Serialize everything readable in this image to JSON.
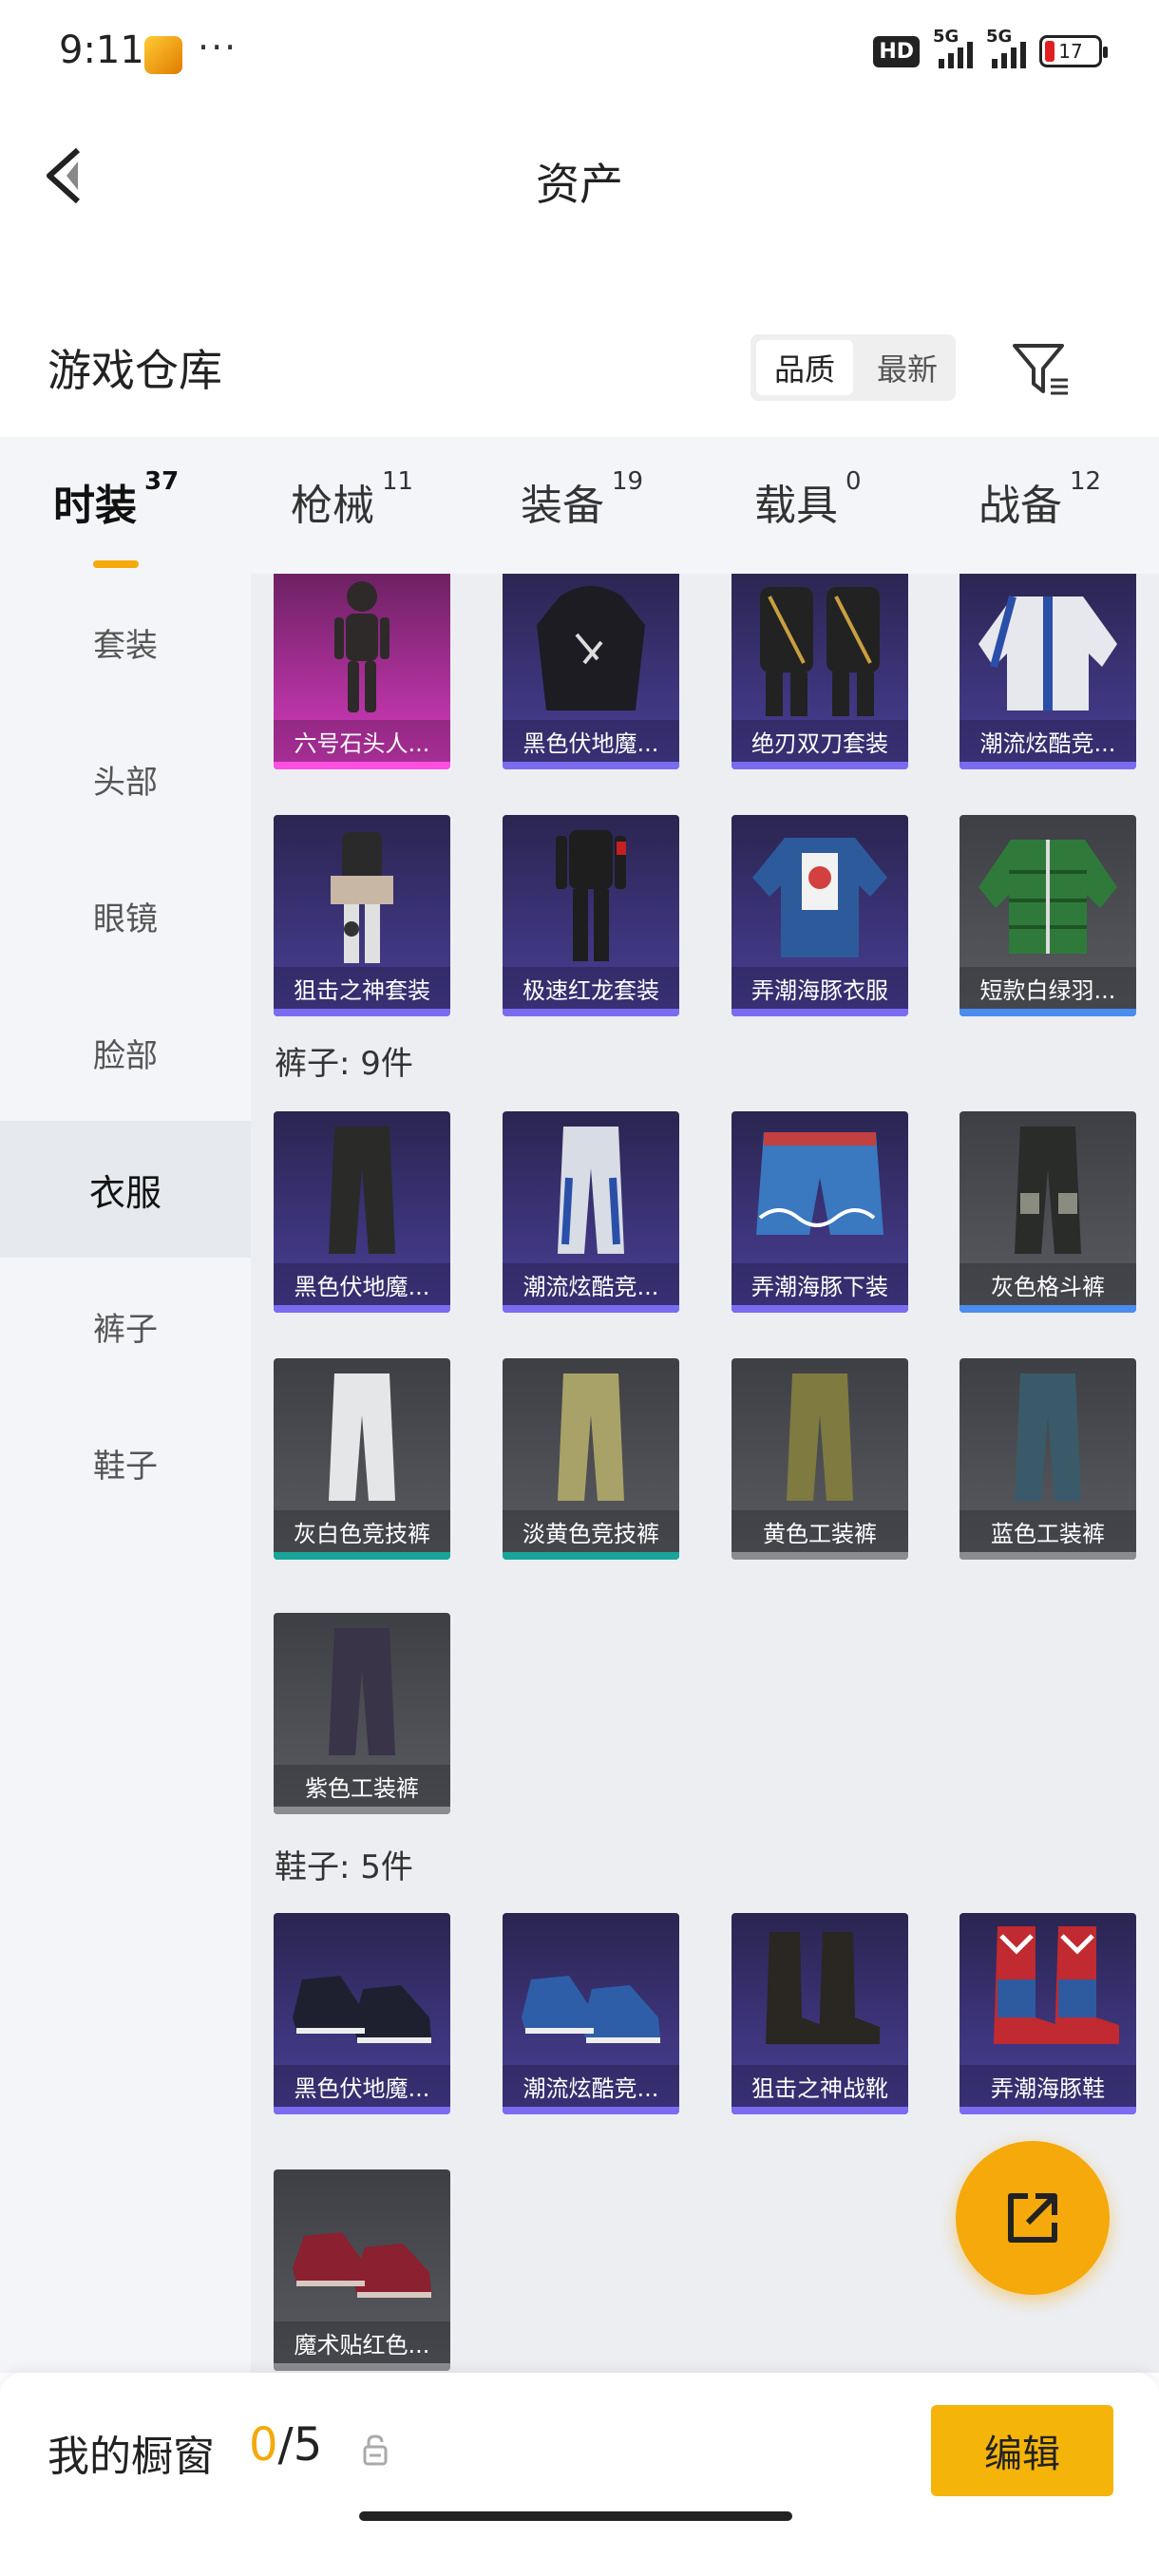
{
  "status": {
    "time": "9:11",
    "dots": "···",
    "hd": "HD",
    "net1": "5G",
    "net2": "5G",
    "battery": "17"
  },
  "nav": {
    "title": "资产"
  },
  "warehouse": {
    "title": "游戏仓库",
    "sort_options": [
      "品质",
      "最新"
    ],
    "sort_active": "品质"
  },
  "category_tabs": [
    {
      "label": "时装",
      "count": "37",
      "active": true
    },
    {
      "label": "枪械",
      "count": "11"
    },
    {
      "label": "装备",
      "count": "19"
    },
    {
      "label": "载具",
      "count": "0"
    },
    {
      "label": "战备",
      "count": "12"
    }
  ],
  "sidebar": [
    {
      "label": "套装"
    },
    {
      "label": "头部"
    },
    {
      "label": "眼镜"
    },
    {
      "label": "脸部"
    },
    {
      "label": "衣服",
      "active": true
    },
    {
      "label": "裤子"
    },
    {
      "label": "鞋子"
    }
  ],
  "groups": {
    "clothes": {
      "items": [
        {
          "label": "六号石头人...",
          "rarity": "pink",
          "icon": "armor-suit-icon"
        },
        {
          "label": "黑色伏地魔...",
          "rarity": "purple",
          "icon": "hoodie-icon"
        },
        {
          "label": "绝刃双刀套装",
          "rarity": "purple",
          "icon": "outfit-pair-icon"
        },
        {
          "label": "潮流炫酷竞...",
          "rarity": "purple",
          "icon": "jacket-icon"
        },
        {
          "label": "狙击之神套装",
          "rarity": "purple",
          "icon": "outfit-icon"
        },
        {
          "label": "极速红龙套装",
          "rarity": "purple",
          "icon": "outfit-icon"
        },
        {
          "label": "弄潮海豚衣服",
          "rarity": "purple",
          "icon": "shirt-icon"
        },
        {
          "label": "短款白绿羽...",
          "rarity": "grey-blue",
          "icon": "down-jacket-icon"
        }
      ]
    },
    "pants": {
      "title": "裤子: 9件",
      "items": [
        {
          "label": "黑色伏地魔...",
          "rarity": "purple",
          "icon": "pants-icon"
        },
        {
          "label": "潮流炫酷竞...",
          "rarity": "purple",
          "icon": "pants-icon"
        },
        {
          "label": "弄潮海豚下装",
          "rarity": "purple",
          "icon": "shorts-icon"
        },
        {
          "label": "灰色格斗裤",
          "rarity": "grey-blue",
          "icon": "pants-icon"
        },
        {
          "label": "灰白色竞技裤",
          "rarity": "grey-teal",
          "icon": "pants-icon"
        },
        {
          "label": "淡黄色竞技裤",
          "rarity": "grey-teal",
          "icon": "pants-icon"
        },
        {
          "label": "黄色工装裤",
          "rarity": "grey",
          "icon": "pants-icon"
        },
        {
          "label": "蓝色工装裤",
          "rarity": "grey",
          "icon": "pants-icon"
        },
        {
          "label": "紫色工装裤",
          "rarity": "grey",
          "icon": "pants-icon"
        }
      ]
    },
    "shoes": {
      "title": "鞋子: 5件",
      "items": [
        {
          "label": "黑色伏地魔...",
          "rarity": "purple",
          "icon": "sneakers-icon"
        },
        {
          "label": "潮流炫酷竞...",
          "rarity": "purple",
          "icon": "sneakers-icon"
        },
        {
          "label": "狙击之神战靴",
          "rarity": "purple",
          "icon": "boots-icon"
        },
        {
          "label": "弄潮海豚鞋",
          "rarity": "purple",
          "icon": "high-boots-icon"
        },
        {
          "label": "魔术贴红色...",
          "rarity": "grey",
          "icon": "sneakers-icon"
        }
      ]
    }
  },
  "fab": {
    "icon": "share-external-icon"
  },
  "showcase": {
    "label": "我的橱窗",
    "current": "0",
    "total": "/5",
    "edit_label": "编辑"
  },
  "colors": {
    "accent": "#f5a90a",
    "purple": "#4a3f98",
    "pink": "#d93cc2",
    "grey": "#5a5c62"
  }
}
